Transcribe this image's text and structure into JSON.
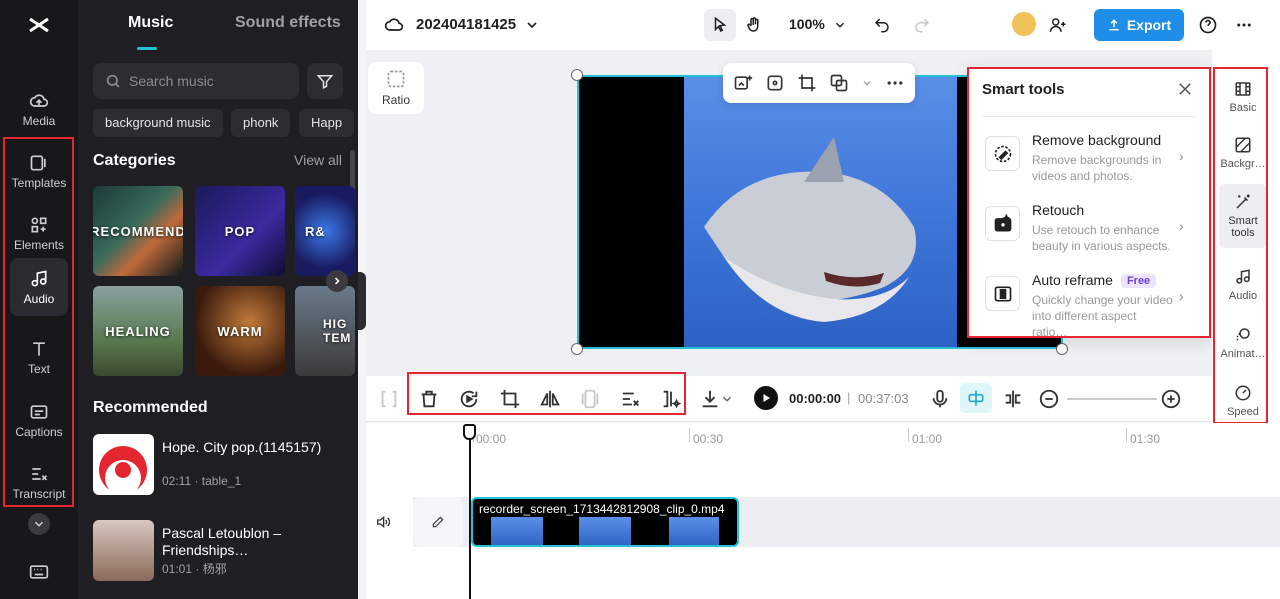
{
  "rail": {
    "items": [
      {
        "label": "Media",
        "icon": "cloud-icon"
      },
      {
        "label": "Templates",
        "icon": "templates-icon"
      },
      {
        "label": "Elements",
        "icon": "elements-icon"
      },
      {
        "label": "Audio",
        "icon": "music-note-icon"
      },
      {
        "label": "Text",
        "icon": "text-icon"
      },
      {
        "label": "Captions",
        "icon": "captions-icon"
      },
      {
        "label": "Transcript",
        "icon": "transcript-icon"
      }
    ]
  },
  "panel": {
    "tabs": [
      "Music",
      "Sound effects"
    ],
    "search_placeholder": "Search music",
    "chips": [
      "background music",
      "phonk",
      "Happ"
    ],
    "categories_title": "Categories",
    "view_all": "View all",
    "categories": [
      "RECOMMEND",
      "POP",
      "R&",
      "HEALING",
      "WARM",
      "HIG TEM"
    ],
    "recommended_title": "Recommended",
    "songs": [
      {
        "name": "Hope. City pop.(1145157)",
        "meta": "02:11 · table_1"
      },
      {
        "name": "Pascal Letoublon – Friendships…",
        "meta": "01:01 · 杨邪"
      }
    ]
  },
  "topbar": {
    "project_title": "202404181425",
    "zoom": "100%",
    "export_label": "Export"
  },
  "canvas": {
    "ratio_label": "Ratio"
  },
  "smart_tools": {
    "title": "Smart tools",
    "tools": [
      {
        "name": "Remove background",
        "desc": "Remove backgrounds in videos and photos."
      },
      {
        "name": "Retouch",
        "desc": "Use retouch to enhance beauty in various aspects."
      },
      {
        "name": "Auto reframe",
        "badge": "Free",
        "desc": "Quickly change your video into different aspect ratio…"
      }
    ]
  },
  "right_rail": {
    "items": [
      "Basic",
      "Backgr…",
      "Smart tools",
      "Audio",
      "Animat…",
      "Speed"
    ]
  },
  "timeline": {
    "current_time": "00:00:00",
    "separator": "|",
    "total_time": "00:37:03",
    "ruler": [
      "00:00",
      "00:30",
      "01:00",
      "01:30"
    ],
    "clip_name": "recorder_screen_1713442812908_clip_0.mp4"
  },
  "colors": {
    "accent": "#22c1d8",
    "export": "#1e8ee8",
    "highlight_box": "#e3262f"
  }
}
